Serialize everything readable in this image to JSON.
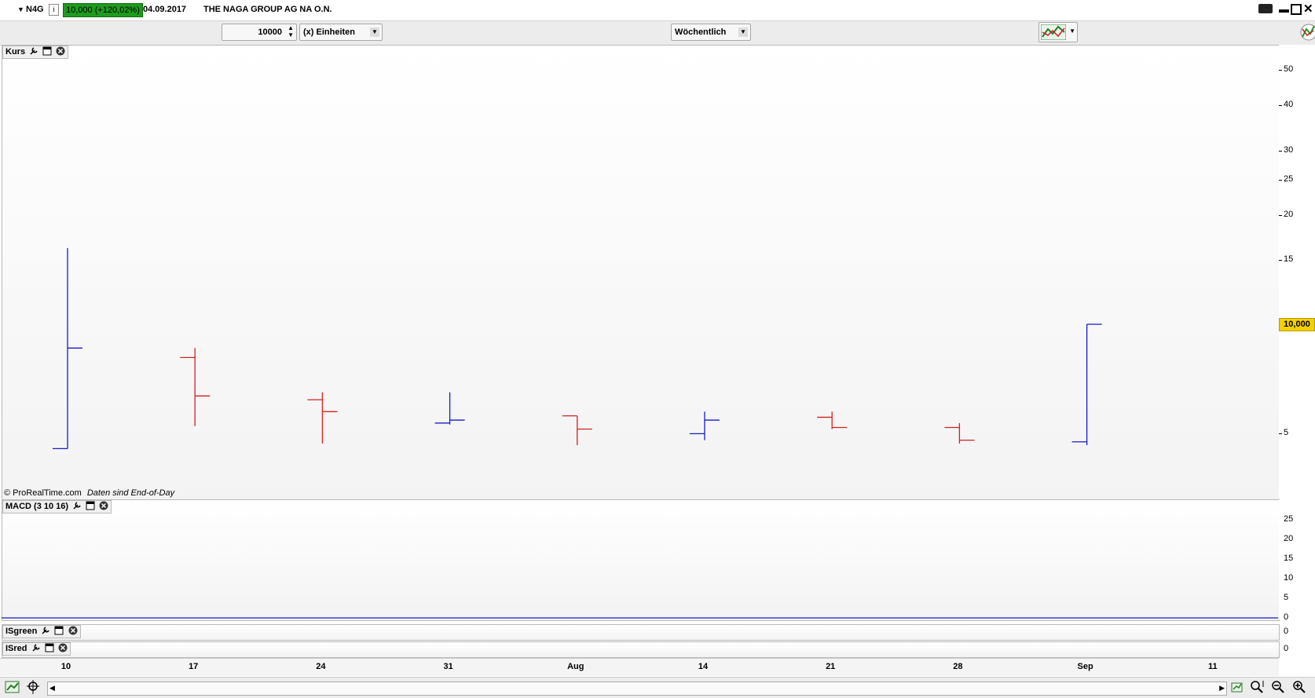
{
  "header": {
    "symbol": "N4G",
    "price_badge": "10,000 (+120,02%)",
    "date": "04.09.2017",
    "company": "THE NAGA GROUP AG NA O.N.",
    "badge_color": "#1e9b1e"
  },
  "toolbar": {
    "quantity": "10000",
    "unit_select": "(x) Einheiten",
    "period_select": "Wöchentlich"
  },
  "panels": {
    "kurs": {
      "title": "Kurs",
      "footer_brand": "© ProRealTime.com",
      "footer_note": "Daten sind End-of-Day"
    },
    "macd": {
      "title": "MACD (3 10 16)"
    },
    "isgreen": {
      "title": "ISgreen",
      "value": "0"
    },
    "isred": {
      "title": "ISred",
      "value": "0"
    }
  },
  "price_label": "10,000",
  "y_ticks_price": [
    "50",
    "40",
    "30",
    "25",
    "20",
    "15",
    "10,000",
    "5"
  ],
  "y_ticks_macd": [
    "25",
    "20",
    "15",
    "10",
    "5",
    "0"
  ],
  "x_ticks": [
    "10",
    "17",
    "24",
    "31",
    "Aug",
    "14",
    "21",
    "28",
    "Sep",
    "11"
  ],
  "colors": {
    "up": "#1a1ac8",
    "down": "#d42020",
    "price_tag": "#f5d000"
  },
  "chart_data": {
    "type": "ohlc",
    "title": "THE NAGA GROUP AG NA O.N.",
    "period": "Wöchentlich",
    "y_scale": "log",
    "ylim": [
      3.4,
      55
    ],
    "categories": [
      "10",
      "17",
      "24",
      "31",
      "Aug",
      "14",
      "21",
      "28",
      "Sep"
    ],
    "series": [
      {
        "open": 4.55,
        "high": 16.2,
        "low": 4.55,
        "close": 8.6
      },
      {
        "open": 8.1,
        "high": 8.6,
        "low": 5.25,
        "close": 6.35
      },
      {
        "open": 6.2,
        "high": 6.5,
        "low": 4.7,
        "close": 5.75
      },
      {
        "open": 5.35,
        "high": 6.5,
        "low": 5.3,
        "close": 5.45
      },
      {
        "open": 5.6,
        "high": 5.6,
        "low": 4.65,
        "close": 5.15
      },
      {
        "open": 5.0,
        "high": 5.75,
        "low": 4.8,
        "close": 5.45
      },
      {
        "open": 5.55,
        "high": 5.75,
        "low": 5.15,
        "close": 5.2
      },
      {
        "open": 5.2,
        "high": 5.35,
        "low": 4.7,
        "close": 4.8
      },
      {
        "open": 4.75,
        "high": 10.0,
        "low": 4.65,
        "close": 10.0
      }
    ],
    "macd": {
      "ylim": [
        0,
        27
      ],
      "baseline": 0
    }
  }
}
